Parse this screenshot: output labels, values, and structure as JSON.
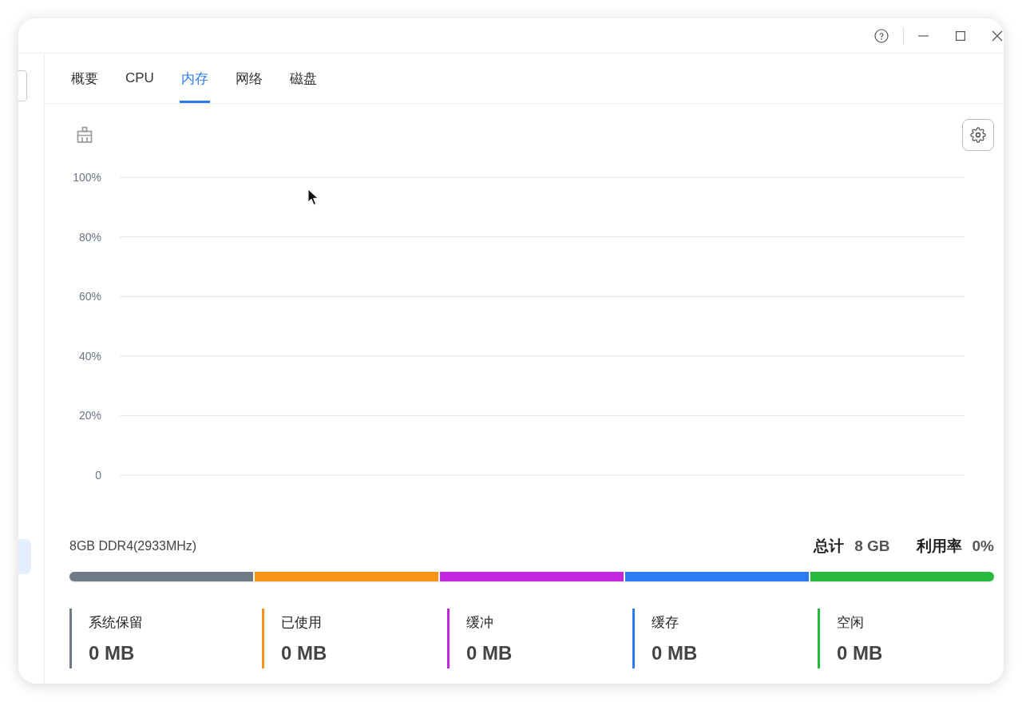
{
  "sidebar": {
    "items": [
      {
        "selected": true
      }
    ]
  },
  "tabs": [
    {
      "label": "概要",
      "selected": false
    },
    {
      "label": "CPU",
      "selected": false
    },
    {
      "label": "内存",
      "selected": true
    },
    {
      "label": "网络",
      "selected": false
    },
    {
      "label": "磁盘",
      "selected": false
    }
  ],
  "memory_chart": {
    "y_axis_labels": [
      "100%",
      "80%",
      "60%",
      "40%",
      "20%",
      "0"
    ]
  },
  "memory": {
    "spec": "8GB DDR4(2933MHz)",
    "summary": [
      {
        "label": "总计",
        "value": "8 GB"
      },
      {
        "label": "利用率",
        "value": "0%"
      }
    ],
    "breakdown": [
      {
        "label": "系统保留",
        "value": "0 MB",
        "color": "#6e7a88"
      },
      {
        "label": "已使用",
        "value": "0 MB",
        "color": "#fa9419"
      },
      {
        "label": "缓冲",
        "value": "0 MB",
        "color": "#c128e0"
      },
      {
        "label": "缓存",
        "value": "0 MB",
        "color": "#2b7bf4"
      },
      {
        "label": "空闲",
        "value": "0 MB",
        "color": "#27b93b"
      }
    ]
  }
}
